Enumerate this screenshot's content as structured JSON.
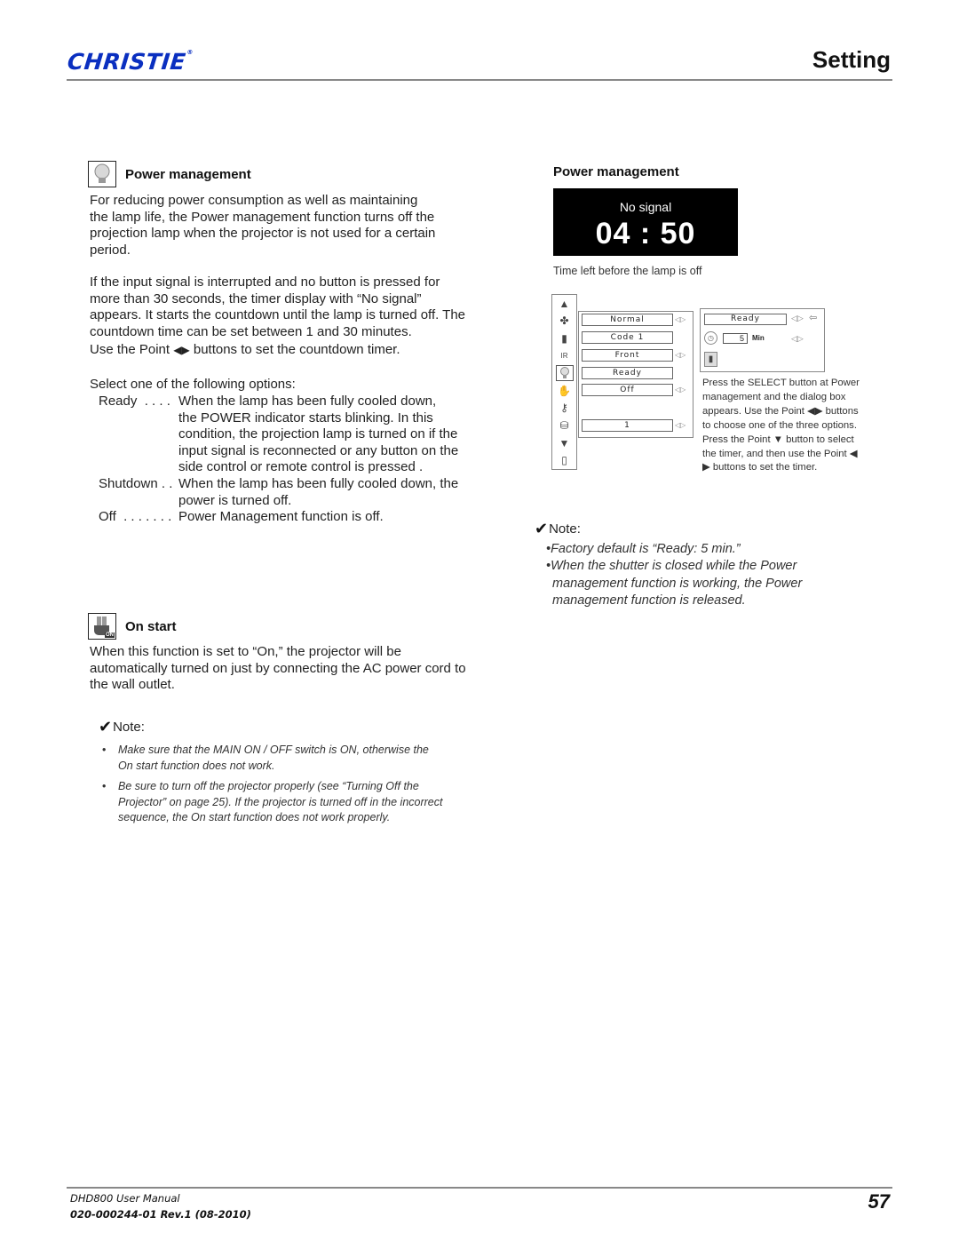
{
  "header": {
    "brand": "CHRISTIE",
    "brand_mark": "®",
    "section_title": "Setting"
  },
  "power_management": {
    "icon": "lightbulb-icon",
    "heading": "Power management",
    "intro": [
      "For reducing power consumption as well as maintaining",
      "the lamp life, the Power management function turns off the",
      "projection lamp when the projector is not used for a certain",
      "period."
    ],
    "signal_para": [
      "If the input signal is interrupted and no button is pressed for",
      "more than 30 seconds, the timer display with “No signal”",
      "appears. It starts the countdown until the lamp is turned off. The",
      "countdown time can be set between 1 and 30 minutes."
    ],
    "point_line_pre": "Use the Point ",
    "point_arrows": "◀▶",
    "point_line_post": " buttons to set the countdown timer.",
    "select_intro": "Select one of the following options:",
    "options": [
      {
        "key": "Ready  . . . .",
        "lines": [
          "When the lamp has been fully cooled down,",
          "the POWER indicator starts blinking. In this",
          "condition, the projection lamp is turned on if the",
          "input signal is reconnected or any button on the",
          "side control or remote control is pressed ."
        ]
      },
      {
        "key": "Shutdown . .",
        "lines": [
          "When the lamp has been fully cooled down, the",
          "power is turned off."
        ]
      },
      {
        "key": "Off  . . . . . . .",
        "lines": [
          "Power Management function is off."
        ]
      }
    ]
  },
  "on_start": {
    "icon": "power-plug-on-icon",
    "icon_badge": "ON",
    "heading": "On start",
    "body": [
      "When this function is set to “On,” the projector will be",
      "automatically turned on just by connecting the AC power cord to",
      "the wall outlet."
    ],
    "note_label": "Note:",
    "notes": [
      [
        "Make sure that the MAIN ON / OFF switch is ON, otherwise the",
        "On start function does not work."
      ],
      [
        "Be sure to turn off the projector properly (see “Turning Off the",
        "Projector” on page 25). If the projector is turned off in the incorrect",
        "sequence, the On start function does not work properly."
      ]
    ]
  },
  "right": {
    "heading": "Power management",
    "osd": {
      "status": "No signal",
      "time": "04 : 50"
    },
    "osd_caption": "Time left before the lamp is off",
    "menu_icons": [
      "up-arrow-icon",
      "fan-icon",
      "remote-icon",
      "ir-icon",
      "lightbulb-icon",
      "on-start-icon",
      "key-icon",
      "lens-icon",
      "down-arrow-icon",
      "exit-icon"
    ],
    "menu_fields": [
      "Normal",
      "Code 1",
      "Front",
      "Ready",
      "Off",
      "1"
    ],
    "dialog": {
      "mode": "Ready",
      "timer_value": "5",
      "timer_unit": "Min"
    },
    "side_caption": [
      "Press the SELECT button at Power",
      "management and the dialog box",
      "appears. Use the Point ◀▶ buttons",
      "to choose one of the three options.",
      "Press the Point ▼ button to select",
      "the timer, and then use the Point ◀",
      "▶ buttons to set the timer."
    ],
    "note_label": "Note:",
    "notes": [
      [
        "•Factory default is “Ready: 5 min.”"
      ],
      [
        "•When the shutter is closed while the Power",
        "management function is working, the Power",
        "management function is released."
      ]
    ]
  },
  "footer": {
    "manual": "DHD800 User Manual",
    "revision": "020-000244-01 Rev.1 (08-2010)",
    "page": "57"
  }
}
